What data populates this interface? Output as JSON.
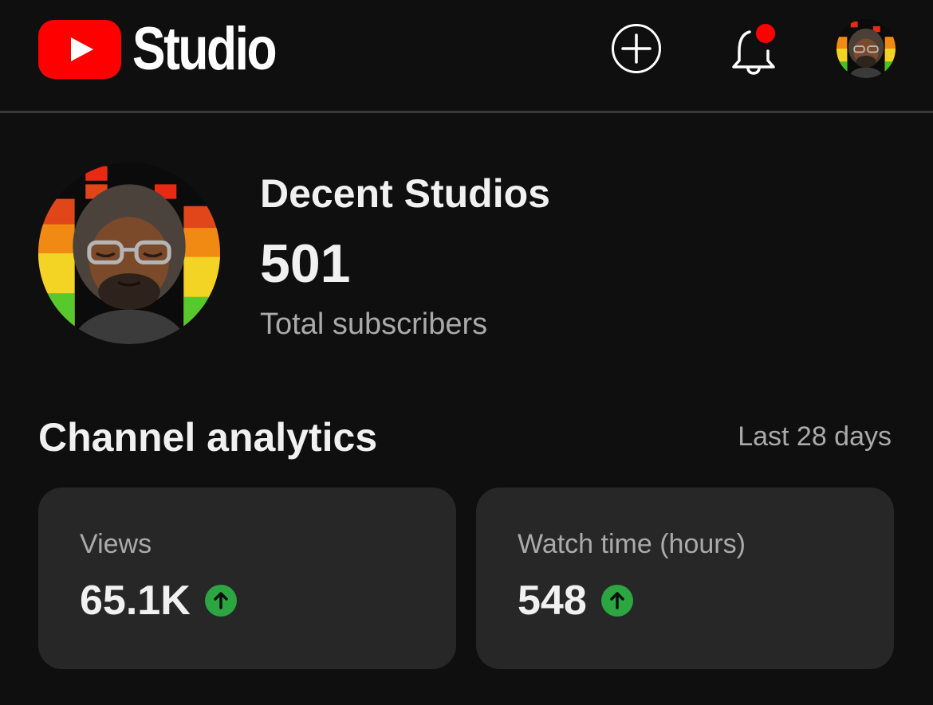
{
  "header": {
    "logo_text": "Studio",
    "create_icon": "plus-circle-icon",
    "notifications_icon": "bell-icon",
    "has_unread_notifications": true,
    "account_icon": "avatar"
  },
  "channel": {
    "name": "Decent Studios",
    "subscriber_count": "501",
    "subscriber_label": "Total subscribers"
  },
  "analytics": {
    "title": "Channel analytics",
    "period": "Last 28 days",
    "cards": [
      {
        "label": "Views",
        "value": "65.1K",
        "trend": "up",
        "trend_icon": "arrow-up-icon"
      },
      {
        "label": "Watch time (hours)",
        "value": "548",
        "trend": "up",
        "trend_icon": "arrow-up-icon"
      }
    ]
  },
  "colors": {
    "background": "#0f0f0f",
    "card": "#272727",
    "brand_red": "#ff0000",
    "trend_up": "#2ba640",
    "secondary_text": "#aaaaaa"
  }
}
